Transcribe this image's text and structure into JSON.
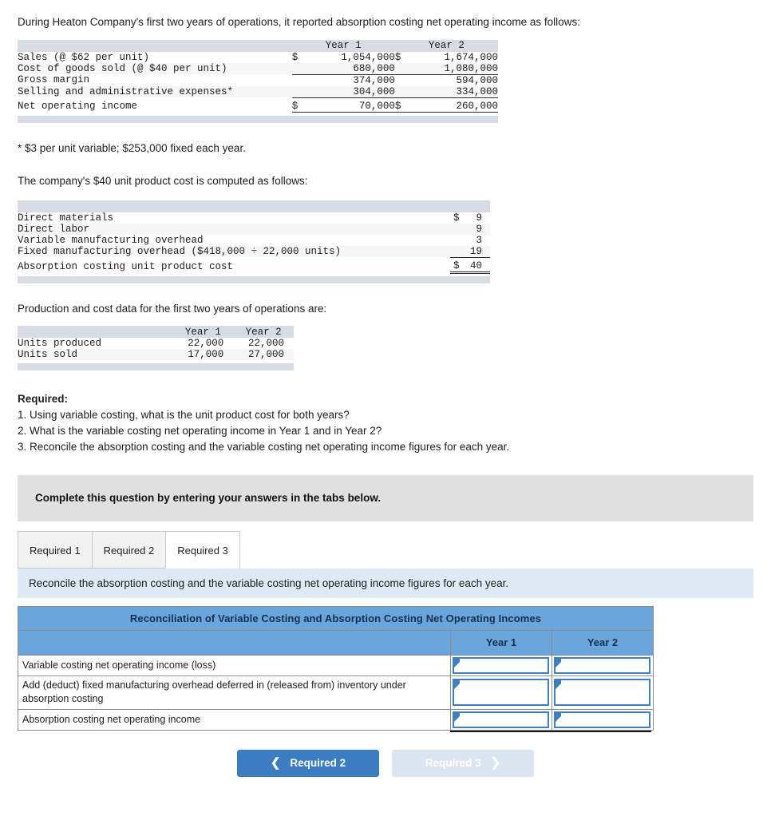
{
  "intro": "During Heaton Company's first two years of operations, it reported absorption costing net operating income as follows:",
  "income_table": {
    "columns": [
      "Year 1",
      "Year 2"
    ],
    "rows": [
      {
        "label": "Sales (@ $62 per unit)",
        "y1_cur": "$",
        "y1": "1,054,000",
        "y2_cur": "$",
        "y2": "1,674,000",
        "rule": "none"
      },
      {
        "label": "Cost of goods sold (@ $40 per unit)",
        "y1_cur": "",
        "y1": "680,000",
        "y2_cur": "",
        "y2": "1,080,000",
        "rule": "single"
      },
      {
        "label": "Gross margin",
        "y1_cur": "",
        "y1": "374,000",
        "y2_cur": "",
        "y2": "594,000",
        "rule": "none"
      },
      {
        "label": "Selling and administrative expenses*",
        "y1_cur": "",
        "y1": "304,000",
        "y2_cur": "",
        "y2": "334,000",
        "rule": "single"
      },
      {
        "label": "Net operating income",
        "y1_cur": "$",
        "y1": "70,000",
        "y2_cur": "$",
        "y2": "260,000",
        "rule": "single"
      }
    ]
  },
  "footnote": "* $3 per unit variable; $253,000 fixed each year.",
  "lead_unitcost": "The company's $40 unit product cost is computed as follows:",
  "unitcost_table": {
    "rows": [
      {
        "label": "Direct materials",
        "cur": "$",
        "value": "9",
        "rule": "none"
      },
      {
        "label": "Direct labor",
        "cur": "",
        "value": "9",
        "rule": "none"
      },
      {
        "label": "Variable manufacturing overhead",
        "cur": "",
        "value": "3",
        "rule": "none"
      },
      {
        "label": "Fixed manufacturing overhead ($418,000 ÷ 22,000 units)",
        "cur": "",
        "value": "19",
        "rule": "single"
      },
      {
        "label": "Absorption costing unit product cost",
        "cur": "$",
        "value": "40",
        "rule": "double"
      }
    ]
  },
  "lead_production": "Production and cost data for the first two years of operations are:",
  "units_table": {
    "columns": [
      "Year 1",
      "Year 2"
    ],
    "rows": [
      {
        "label": "Units produced",
        "y1": "22,000",
        "y2": "22,000"
      },
      {
        "label": "Units sold",
        "y1": "17,000",
        "y2": "27,000"
      }
    ]
  },
  "required": {
    "title": "Required:",
    "items": [
      "1. Using variable costing, what is the unit product cost for both years?",
      "2. What is the variable costing net operating income in Year 1 and in Year 2?",
      "3. Reconcile the absorption costing and the variable costing net operating income figures for each year."
    ]
  },
  "banner": "Complete this question by entering your answers in the tabs below.",
  "tabs": [
    {
      "label": "Required 1",
      "active": false
    },
    {
      "label": "Required 2",
      "active": false
    },
    {
      "label": "Required 3",
      "active": true
    }
  ],
  "instruction": "Reconcile the absorption costing and the variable costing net operating income figures for each year.",
  "recon": {
    "title": "Reconciliation of Variable Costing and Absorption Costing Net Operating Incomes",
    "columns": [
      "Year 1",
      "Year 2"
    ],
    "rows": [
      {
        "label": "Variable costing net operating income (loss)",
        "y1": "",
        "y2": "",
        "tall": false
      },
      {
        "label": "Add (deduct) fixed manufacturing overhead deferred in (released from) inventory under absorption costing",
        "y1": "",
        "y2": "",
        "tall": true
      },
      {
        "label": "Absorption costing net operating income",
        "y1": "",
        "y2": "",
        "tall": false
      }
    ]
  },
  "nav": {
    "prev_label": "Required 2",
    "prev_icon": "chevron-left-icon",
    "next_label": "Required 3",
    "next_icon": "chevron-right-icon"
  },
  "colors": {
    "band": "#d6dbe4",
    "banner": "#e0e0e0",
    "instruction": "#ddeaf6",
    "recon_header": "#6aa5dd",
    "input_border": "#3f7fbf",
    "btn_primary": "#3b7dc0",
    "btn_disabled": "#dbe5f1"
  }
}
